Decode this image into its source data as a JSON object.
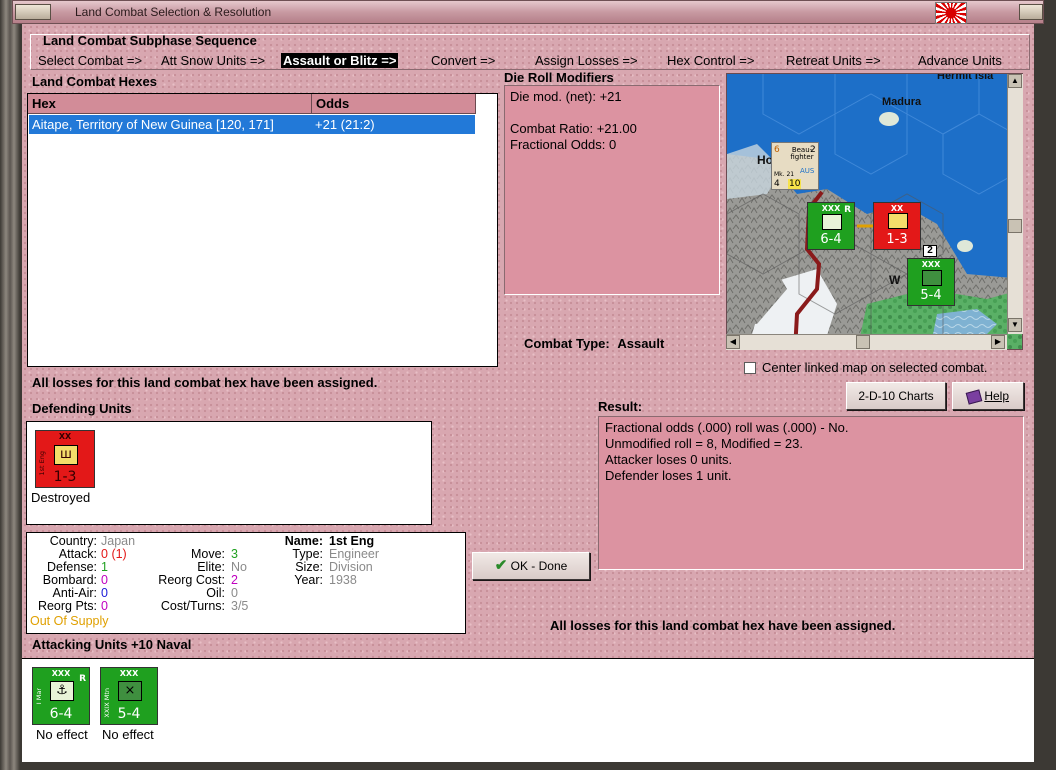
{
  "window": {
    "title": "Land Combat Selection & Resolution"
  },
  "subphase": {
    "heading": "Land Combat Subphase Sequence",
    "steps": [
      "Select Combat =>",
      "Att Snow Units =>",
      "Assault or Blitz =>",
      "Convert =>",
      "Assign Losses =>",
      "Hex Control =>",
      "Retreat Units =>",
      "Advance Units"
    ]
  },
  "hexes": {
    "heading": "Land Combat Hexes",
    "columns": [
      "Hex",
      "Odds"
    ],
    "rows": [
      {
        "hex": "Aitape, Territory of New Guinea [120, 171]",
        "odds": "+21 (21:2)"
      }
    ]
  },
  "modifiers": {
    "heading": "Die Roll Modifiers",
    "lines": [
      "Die mod. (net): +21",
      "",
      "Combat Ratio: +21.00",
      "Fractional Odds: 0"
    ]
  },
  "map": {
    "labels": {
      "hermit": "Hermit Isla",
      "madura": "Madura",
      "hollandia": "Ho",
      "wewak": "W"
    },
    "counters": {
      "air": {
        "name": "Beau-fighter",
        "nation": "AUS",
        "mk": "Mk. 21",
        "att": "6",
        "range": "2",
        "def": "4",
        "move": "10"
      },
      "marine": {
        "size": "XXX",
        "name": "I Mar",
        "val": "6-4",
        "tag": "R"
      },
      "japan": {
        "size": "XX",
        "val": "1-3"
      },
      "corps": {
        "size": "XXX",
        "name": "XXIX Mtn",
        "val": "5-4",
        "stack": "2"
      }
    }
  },
  "combat_type": {
    "label": "Combat Type:",
    "value": "Assault"
  },
  "center_map": {
    "label": "Center linked map on selected combat.",
    "checked": false
  },
  "buttons": {
    "charts": "2-D-10 Charts",
    "help": "Help",
    "ok": "OK - Done"
  },
  "messages": {
    "losses_assigned_left": "All losses for this land combat hex have been assigned.",
    "losses_assigned_right": "All losses for this land combat hex have been assigned."
  },
  "result": {
    "heading": "Result:",
    "lines": [
      "Fractional odds (.000) roll was (.000)  - No.",
      "Unmodified roll = 8, Modified = 23.",
      "Attacker loses 0 units.",
      "Defender loses 1 unit."
    ]
  },
  "defending": {
    "heading": "Defending Units",
    "units": [
      {
        "size": "XX",
        "name": "1st Eng",
        "val": "1-3",
        "status": "Destroyed"
      }
    ]
  },
  "details": {
    "country": {
      "label": "Country:",
      "value": "Japan"
    },
    "attack": {
      "label": "Attack:",
      "value": "0",
      "extra": "(1)"
    },
    "defense": {
      "label": "Defense:",
      "value": "1"
    },
    "bombard": {
      "label": "Bombard:",
      "value": "0"
    },
    "antiair": {
      "label": "Anti-Air:",
      "value": "0"
    },
    "reorgpts": {
      "label": "Reorg Pts:",
      "value": "0"
    },
    "supply": "Out Of Supply",
    "move": {
      "label": "Move:",
      "value": "3"
    },
    "elite": {
      "label": "Elite:",
      "value": "No"
    },
    "reorgcost": {
      "label": "Reorg Cost:",
      "value": "2"
    },
    "oil": {
      "label": "Oil:",
      "value": "0"
    },
    "costturns": {
      "label": "Cost/Turns:",
      "value": "3/5"
    },
    "name": {
      "label": "Name:",
      "value": "1st Eng"
    },
    "type": {
      "label": "Type:",
      "value": "Engineer"
    },
    "size": {
      "label": "Size:",
      "value": "Division"
    },
    "year": {
      "label": "Year:",
      "value": "1938"
    }
  },
  "attacking": {
    "heading": "Attacking Units +10 Naval",
    "units": [
      {
        "size": "XXX",
        "name": "I Mar",
        "val": "6-4",
        "tag": "R",
        "status": "No effect"
      },
      {
        "size": "XXX",
        "name": "XXIX Mtn",
        "val": "5-4",
        "status": "No effect"
      }
    ]
  },
  "colors": {
    "panel_pink": "#dc93a1",
    "selection_blue": "#2279d8",
    "allied_green": "#1fa01f",
    "japan_red": "#e31818",
    "supply_orange": "#e0a000"
  }
}
